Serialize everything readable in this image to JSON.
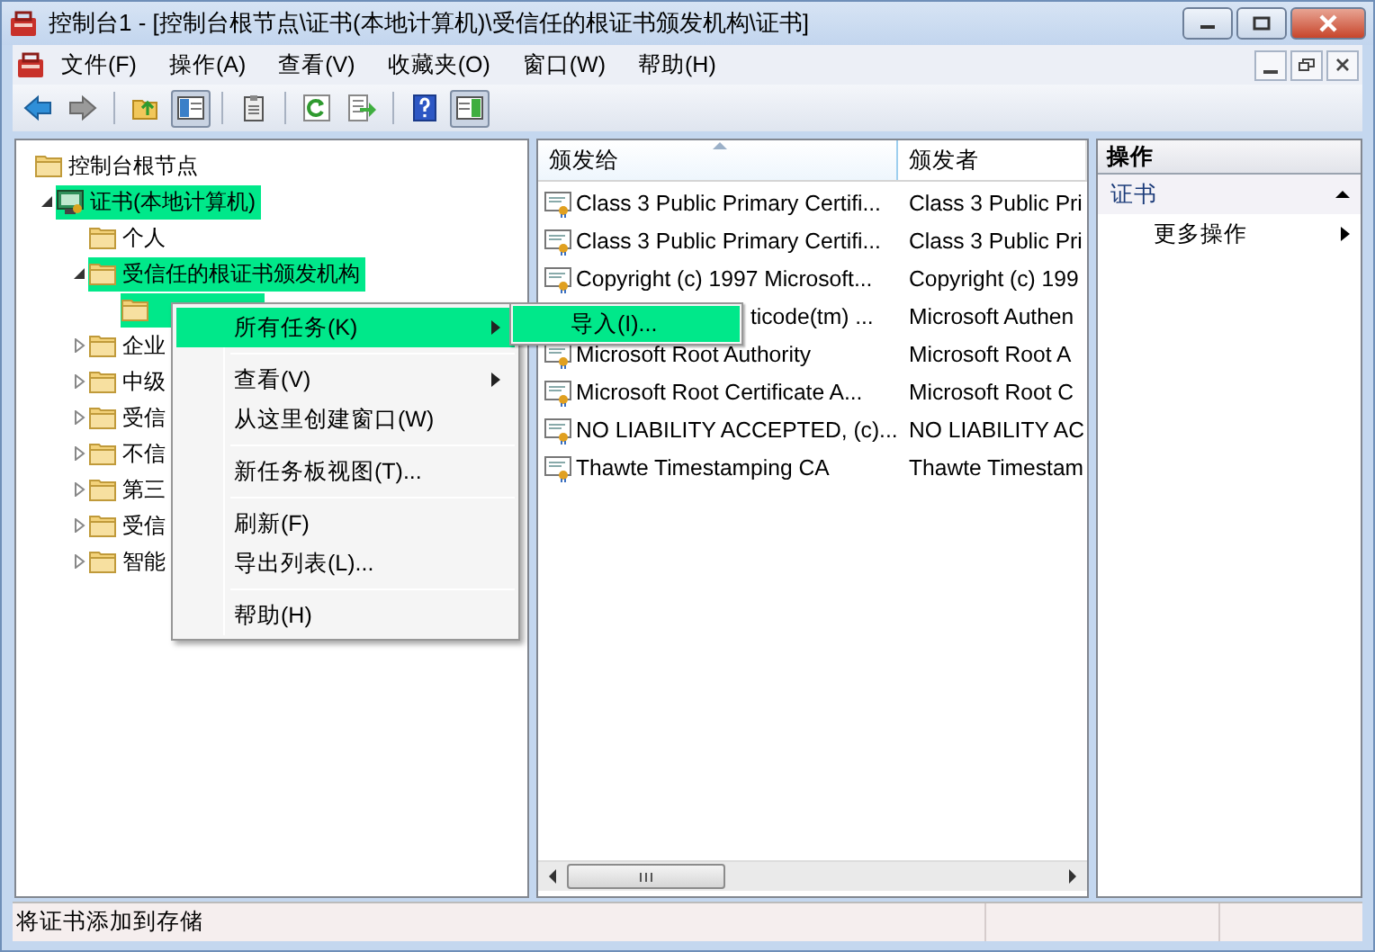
{
  "window": {
    "title": "控制台1 - [控制台根节点\\证书(本地计算机)\\受信任的根证书颁发机构\\证书]"
  },
  "menu_bar": [
    "文件(F)",
    "操作(A)",
    "查看(V)",
    "收藏夹(O)",
    "窗口(W)",
    "帮助(H)"
  ],
  "toolbar": [
    {
      "kind": "back",
      "pressed": false
    },
    {
      "kind": "forward",
      "pressed": false
    },
    {
      "kind": "sep"
    },
    {
      "kind": "up",
      "pressed": false
    },
    {
      "kind": "tree",
      "pressed": true
    },
    {
      "kind": "sep"
    },
    {
      "kind": "clipboard",
      "pressed": false
    },
    {
      "kind": "sep"
    },
    {
      "kind": "refresh",
      "pressed": false
    },
    {
      "kind": "export",
      "pressed": false
    },
    {
      "kind": "sep"
    },
    {
      "kind": "help",
      "pressed": false
    },
    {
      "kind": "actionpane",
      "pressed": true
    }
  ],
  "tree": [
    {
      "label": "控制台根节点",
      "kind": "folder",
      "highlighted": false,
      "children": [
        {
          "label": "证书(本地计算机)",
          "kind": "store",
          "expanded": true,
          "highlighted": true,
          "children": [
            {
              "label": "个人",
              "kind": "folder",
              "highlighted": false
            },
            {
              "label": "受信任的根证书颁发机构",
              "kind": "folder",
              "expanded": true,
              "highlighted": true,
              "children": [
                {
                  "kind": "folder",
                  "highlighted": true
                }
              ]
            },
            {
              "label": "企业",
              "kind": "folder",
              "expanded": false,
              "highlighted": false
            },
            {
              "label": "中级",
              "kind": "folder",
              "expanded": false,
              "highlighted": false
            },
            {
              "label": "受信",
              "kind": "folder",
              "expanded": false,
              "highlighted": false
            },
            {
              "label": "不信",
              "kind": "folder",
              "expanded": false,
              "highlighted": false
            },
            {
              "label": "第三",
              "kind": "folder",
              "expanded": false,
              "highlighted": false
            },
            {
              "label": "受信",
              "kind": "folder",
              "expanded": false,
              "highlighted": false
            },
            {
              "label": "智能",
              "kind": "folder",
              "expanded": false,
              "highlighted": false
            }
          ]
        }
      ]
    }
  ],
  "list": {
    "columns": [
      {
        "label": "颁发给",
        "sorted": true
      },
      {
        "label": "颁发者",
        "sorted": false
      }
    ],
    "rows": [
      {
        "kind": "full",
        "issued_to": "Class 3 Public Primary Certifi...",
        "issued_by": "Class 3 Public Pri"
      },
      {
        "kind": "full",
        "issued_to": "Class 3 Public Primary Certifi...",
        "issued_by": "Class 3 Public Pri"
      },
      {
        "kind": "full",
        "issued_to": "Copyright (c) 1997 Microsoft...",
        "issued_by": "Copyright (c) 199"
      },
      {
        "kind": "partial",
        "issued_to": "ticode(tm) ...",
        "issued_by": "Microsoft Authen"
      },
      {
        "kind": "full",
        "issued_to": "Microsoft Root Authority",
        "issued_by": "Microsoft Root A"
      },
      {
        "kind": "full",
        "issued_to": "Microsoft Root Certificate A...",
        "issued_by": "Microsoft Root C"
      },
      {
        "kind": "full",
        "issued_to": "NO LIABILITY ACCEPTED, (c)...",
        "issued_by": "NO LIABILITY AC"
      },
      {
        "kind": "full",
        "issued_to": "Thawte Timestamping CA",
        "issued_by": "Thawte Timestam"
      }
    ]
  },
  "actions": {
    "title": "操作",
    "groups": [
      {
        "label": "证书",
        "expanded": true,
        "items": [
          "更多操作"
        ]
      }
    ]
  },
  "context_menu": [
    {
      "kind": "item",
      "label": "所有任务(K)",
      "submenu": true,
      "selected": true
    },
    {
      "kind": "separator"
    },
    {
      "kind": "item",
      "label": "查看(V)",
      "submenu": true,
      "selected": false
    },
    {
      "kind": "item",
      "label": "从这里创建窗口(W)",
      "submenu": false,
      "selected": false
    },
    {
      "kind": "separator"
    },
    {
      "kind": "item",
      "label": "新任务板视图(T)...",
      "submenu": false,
      "selected": false
    },
    {
      "kind": "separator"
    },
    {
      "kind": "item",
      "label": "刷新(F)",
      "submenu": false,
      "selected": false
    },
    {
      "kind": "item",
      "label": "导出列表(L)...",
      "submenu": false,
      "selected": false
    },
    {
      "kind": "separator"
    },
    {
      "kind": "item",
      "label": "帮助(H)",
      "submenu": false,
      "selected": false
    }
  ],
  "submenu": [
    {
      "label": "导入(I)...",
      "selected": true
    }
  ],
  "status_bar": {
    "text": "将证书添加到存储"
  }
}
